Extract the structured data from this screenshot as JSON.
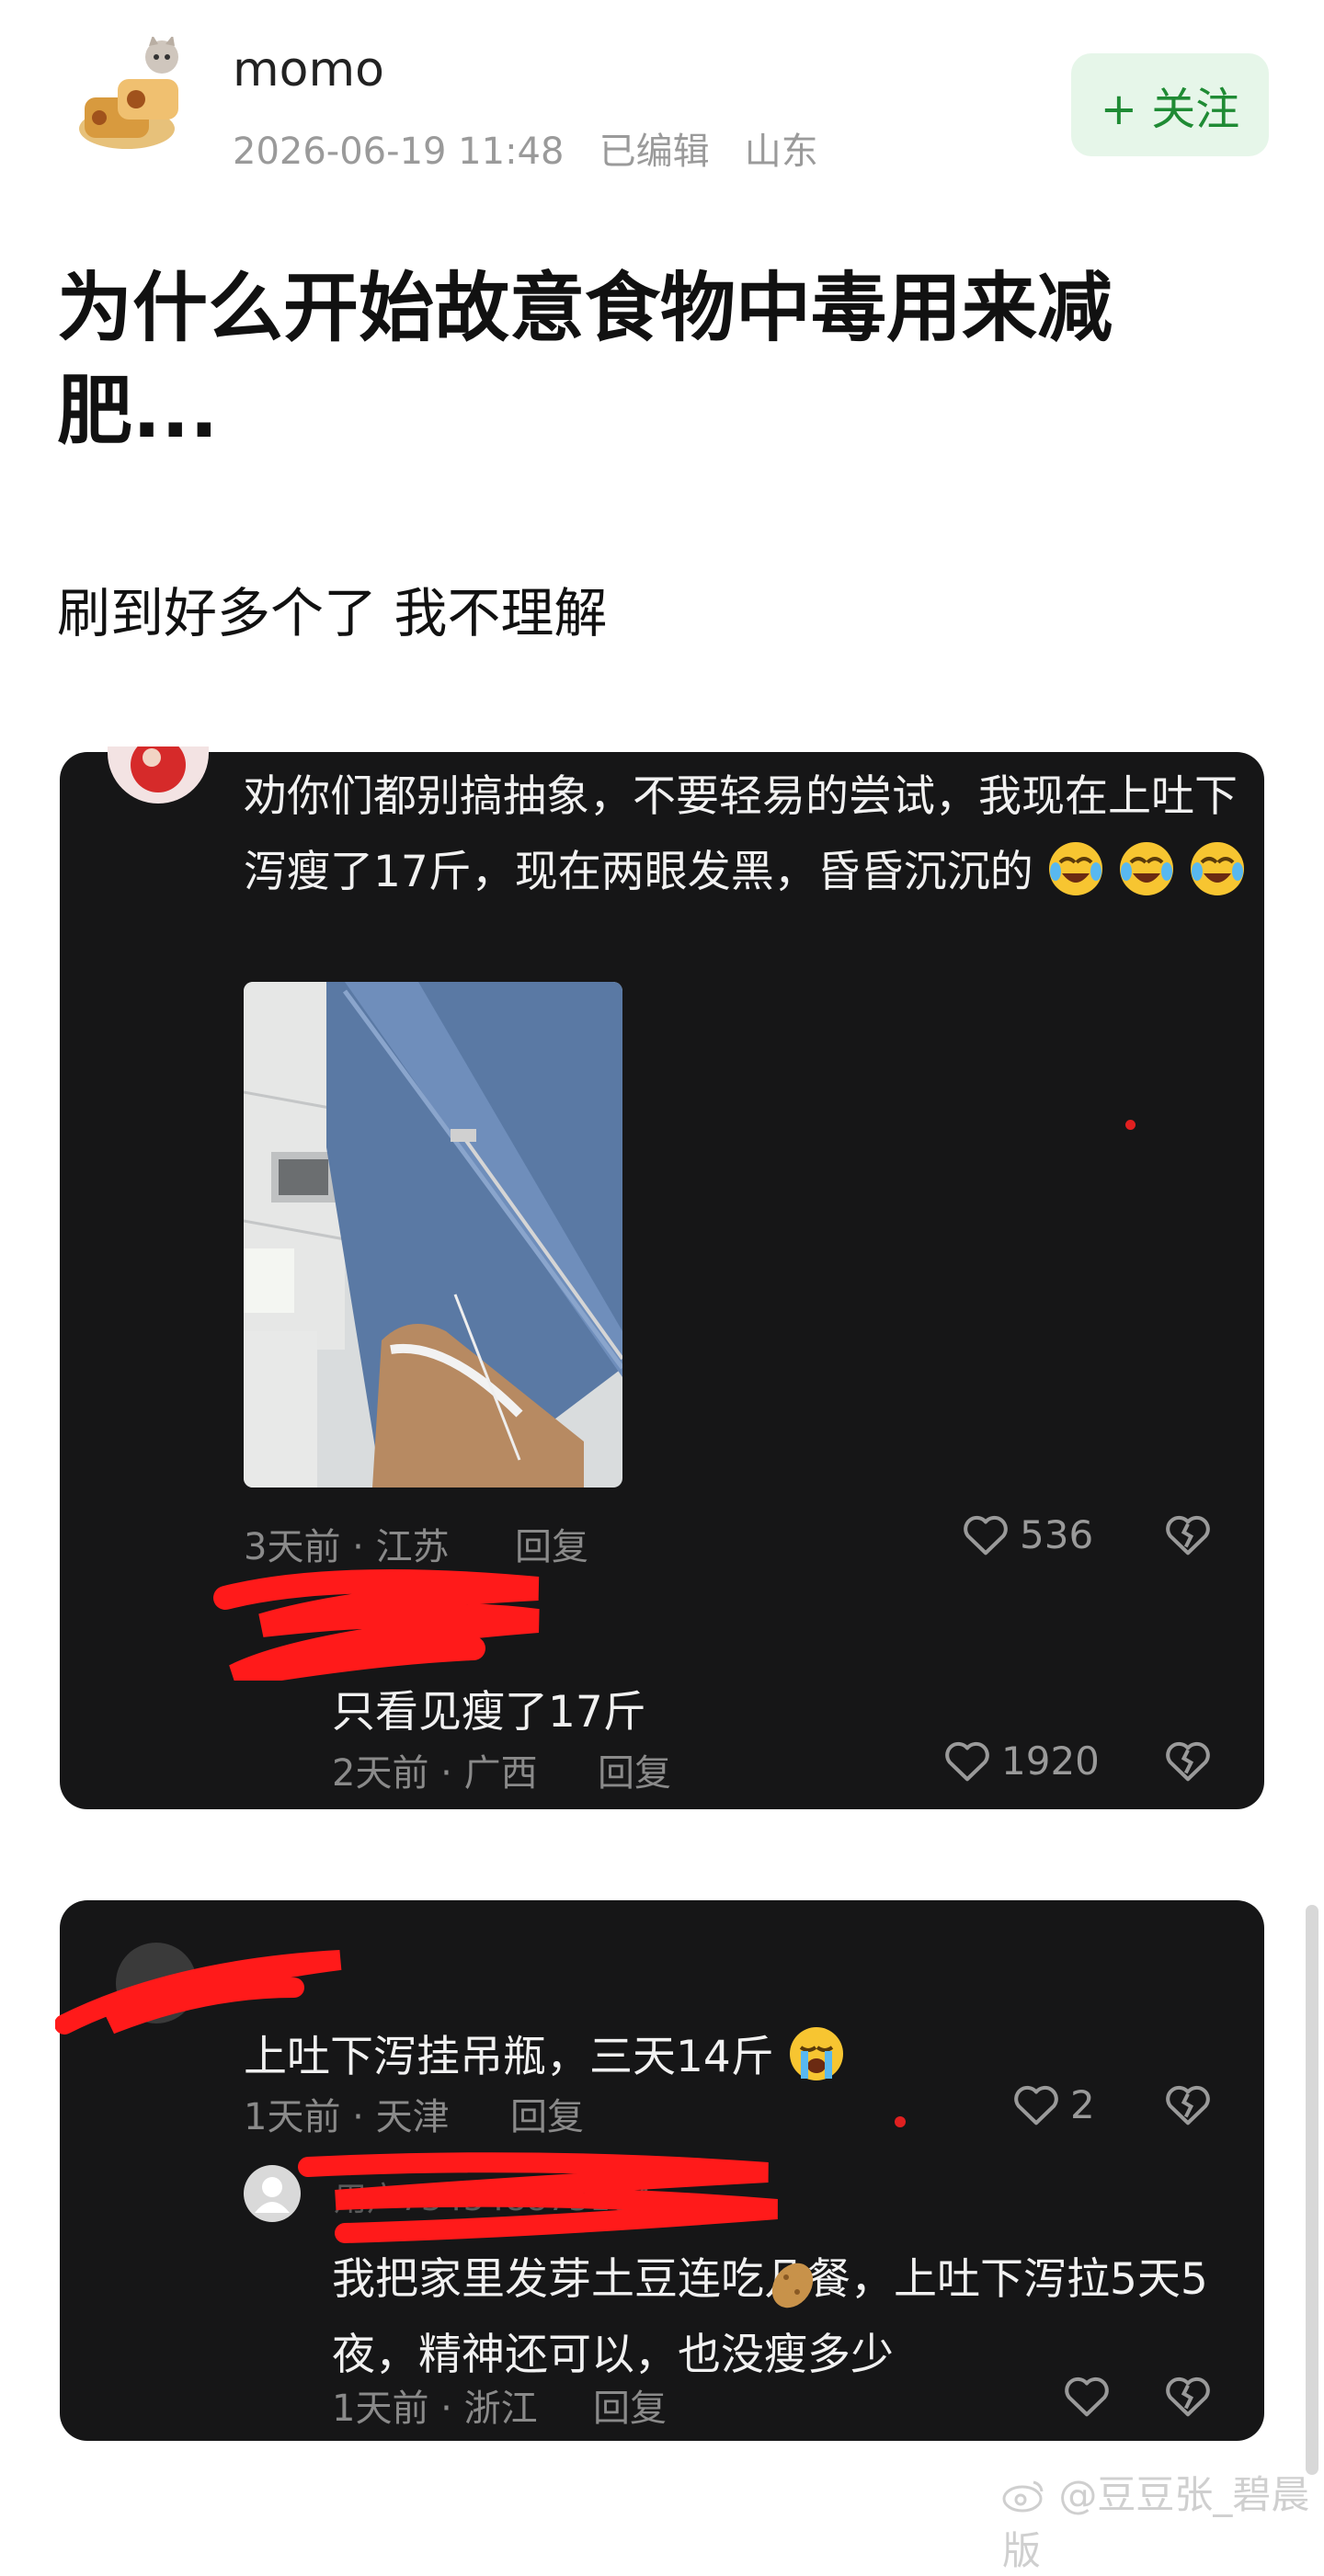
{
  "post": {
    "username": "momo",
    "timestamp": "2026-06-19 11:48",
    "edited": "已编辑",
    "location": "山东",
    "follow_label": "+ 关注",
    "title": "为什么开始故意食物中毒用来减肥...",
    "body": "刷到好多个了 我不理解"
  },
  "comments": [
    {
      "text": "劝你们都别搞抽象，不要轻易的尝试，我现在上吐下泻瘦了17斤，现在两眼发黑，昏昏沉沉的",
      "time_location": "3天前 · 江苏",
      "reply_label": "回复",
      "likes": "536",
      "has_image": true,
      "replies": [
        {
          "text": "只看见瘦了17斤",
          "time_location": "2天前 · 广西",
          "reply_label": "回复",
          "likes": "1920"
        }
      ]
    },
    {
      "text": "上吐下泻挂吊瓶，三天14斤",
      "time_location": "1天前 · 天津",
      "reply_label": "回复",
      "likes": "2",
      "replies": [
        {
          "username": "用户734348875184",
          "text": "我把家里发芽土豆连吃几餐，上吐下泻拉5天5夜，精神还可以，也没瘦多少",
          "time_location": "1天前 · 浙江",
          "reply_label": "回复",
          "likes": ""
        }
      ]
    }
  ],
  "watermark": "@豆豆张_碧晨版",
  "icons": [
    "heart-icon",
    "broken-heart-icon",
    "crying-laughing-emoji",
    "loudly-crying-emoji",
    "potato-emoji",
    "weibo-logo-icon"
  ],
  "colors": {
    "follow_text": "#1f8b34",
    "follow_bg": "#e6f6e9",
    "card_bg": "#161617",
    "redaction": "#ff1a1a"
  }
}
